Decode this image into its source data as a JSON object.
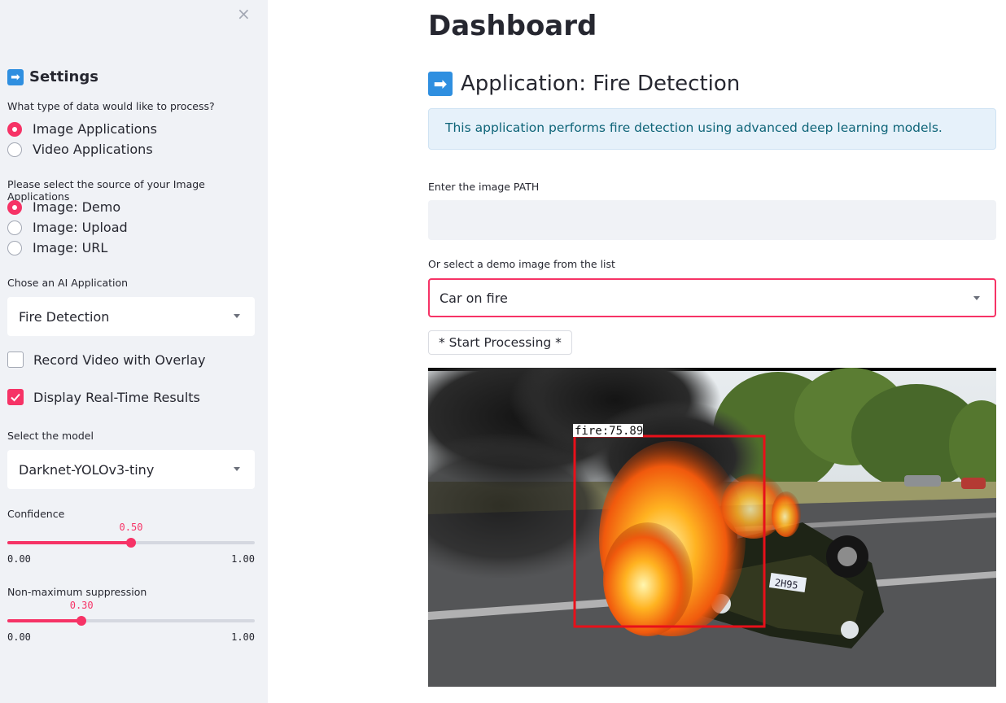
{
  "sidebar": {
    "close_glyph": "×",
    "heading": "Settings",
    "heading_icon": "➡",
    "data_type": {
      "label": "What type of data would like to process?",
      "options": [
        "Image Applications",
        "Video Applications"
      ],
      "selected": 0
    },
    "source": {
      "label": "Please select the source of your Image Applications",
      "options": [
        "Image: Demo",
        "Image: Upload",
        "Image: URL"
      ],
      "selected": 0
    },
    "ai_app": {
      "label": "Chose an AI Application",
      "value": "Fire Detection"
    },
    "record_video": {
      "label": "Record Video with Overlay",
      "checked": false
    },
    "realtime": {
      "label": "Display Real-Time Results",
      "checked": true
    },
    "model": {
      "label": "Select the model",
      "value": "Darknet-YOLOv3-tiny"
    },
    "confidence": {
      "label": "Confidence",
      "value": "0.50",
      "fraction": 0.5,
      "min": "0.00",
      "max": "1.00"
    },
    "nms": {
      "label": "Non-maximum suppression",
      "value": "0.30",
      "fraction": 0.3,
      "min": "0.00",
      "max": "1.00"
    }
  },
  "main": {
    "title": "Dashboard",
    "app_heading_icon": "➡",
    "app_heading": "Application: Fire Detection",
    "info": "This application performs fire detection using advanced deep learning models.",
    "path_label": "Enter the image PATH",
    "path_value": "",
    "demo_label": "Or select a demo image from the list",
    "demo_value": "Car on fire",
    "start_button": "* Start Processing *",
    "detection_label": "fire:75.89"
  },
  "colors": {
    "accent": "#f63366",
    "sidebar_bg": "#f0f2f6",
    "info_bg": "#e6f1fa",
    "info_text": "#0e6478",
    "detection_box": "#e8101a"
  }
}
